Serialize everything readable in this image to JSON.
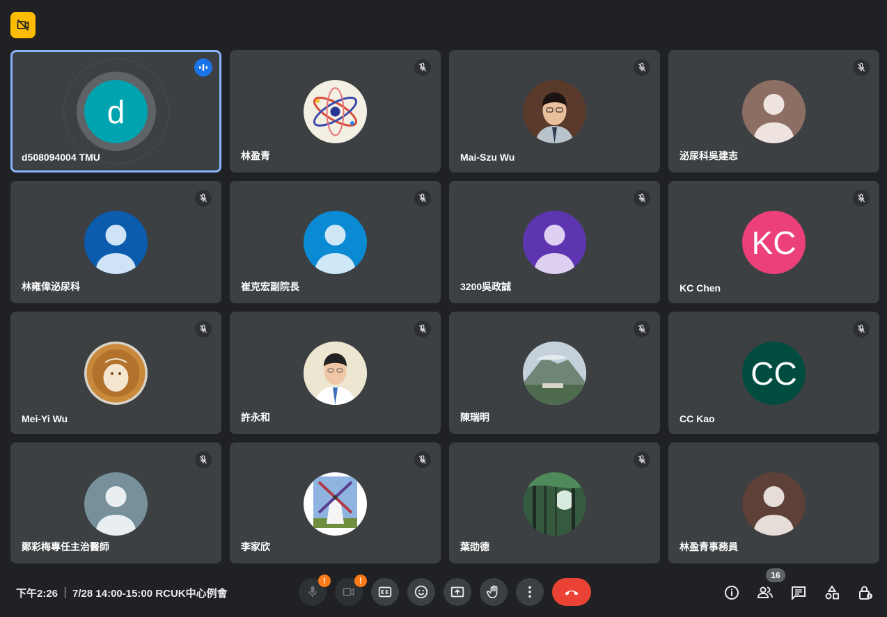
{
  "participants": [
    {
      "name": "d508094004 TMU",
      "initial": "d",
      "avatar_color": "#00a3b0",
      "speaking": true
    },
    {
      "name": "林盈青",
      "avatar_kind": "atom-picture"
    },
    {
      "name": "Mai-Szu Wu",
      "avatar_kind": "portrait-photo"
    },
    {
      "name": "泌尿科吳建志",
      "avatar_kind": "default-person",
      "avatar_color": "#8d6e63"
    },
    {
      "name": "林雍偉泌尿科",
      "avatar_kind": "default-person",
      "avatar_color": "#0b5cad"
    },
    {
      "name": "崔克宏副院長",
      "avatar_kind": "default-person",
      "avatar_color": "#0b8ad4"
    },
    {
      "name": "3200吳政誠",
      "avatar_kind": "default-person",
      "avatar_color": "#5e35b1"
    },
    {
      "name": "KC Chen",
      "initial": "KC",
      "avatar_color": "#ec407a"
    },
    {
      "name": "Mei-Yi Wu",
      "avatar_kind": "latte-art-photo"
    },
    {
      "name": "許永和",
      "avatar_kind": "portrait-photo"
    },
    {
      "name": "陳瑞明",
      "avatar_kind": "mountain-photo"
    },
    {
      "name": "CC Kao",
      "initial": "CC",
      "avatar_color": "#004d40"
    },
    {
      "name": "鄭彩梅專任主治醫師",
      "avatar_kind": "default-person",
      "avatar_color": "#78909c"
    },
    {
      "name": "李家欣",
      "avatar_kind": "windmill-photo"
    },
    {
      "name": "葉劭德",
      "avatar_kind": "forest-photo"
    },
    {
      "name": "林盈青事務員",
      "avatar_kind": "default-person",
      "avatar_color": "#5d4037"
    }
  ],
  "meeting": {
    "time": "下午2:26",
    "title": "7/28 14:00-15:00 RCUK中心例會"
  },
  "people_count": "16",
  "warning_mark": "!",
  "colors": {
    "background": "#202124",
    "tile": "#3c4043",
    "active_border": "#8ab4f8",
    "hangup": "#ea4335",
    "warning": "#fa7b17",
    "top_badge": "#fbbc04"
  },
  "icons": [
    "no-video-icon",
    "mic-off-icon",
    "speaking-icon",
    "mic-icon",
    "camera-icon",
    "captions-icon",
    "emoji-icon",
    "present-icon",
    "raise-hand-icon",
    "more-options-icon",
    "hang-up-icon",
    "info-icon",
    "people-icon",
    "chat-icon",
    "activities-icon",
    "host-controls-icon"
  ]
}
